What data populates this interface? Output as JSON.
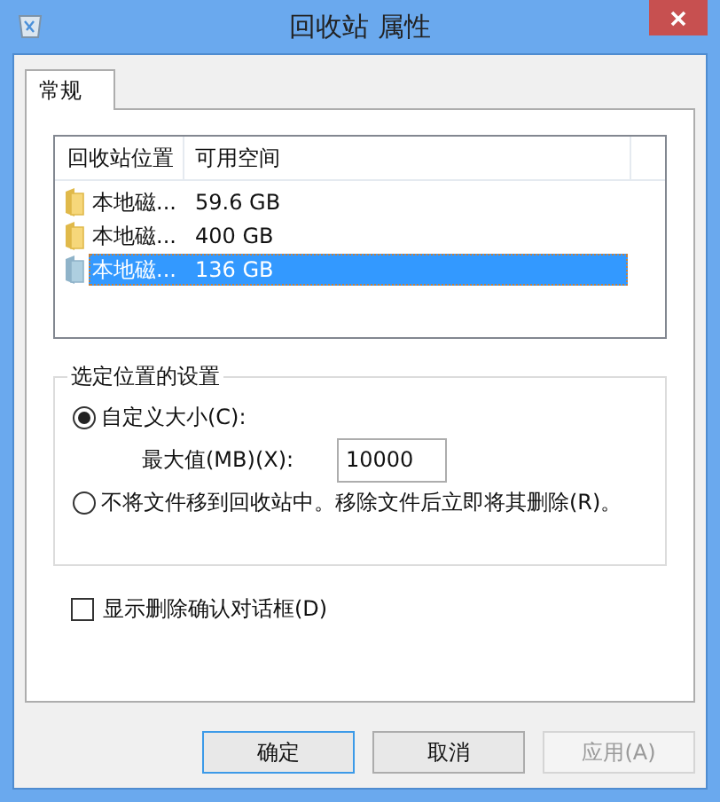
{
  "window": {
    "title": "回收站 属性"
  },
  "tabs": [
    {
      "label": "常规",
      "selected": true
    }
  ],
  "locations": {
    "columns": [
      "回收站位置",
      "可用空间"
    ],
    "rows": [
      {
        "name": "本地磁...",
        "space": "59.6 GB",
        "selected": false
      },
      {
        "name": "本地磁...",
        "space": "400 GB",
        "selected": false
      },
      {
        "name": "本地磁...",
        "space": "136 GB",
        "selected": true
      }
    ]
  },
  "settings": {
    "title": "选定位置的设置",
    "options": [
      {
        "label": "自定义大小(C):",
        "selected": true
      },
      {
        "label": "不将文件移到回收站中。移除文件后立即将其删除(R)。",
        "selected": false
      }
    ],
    "max_size": {
      "label": "最大值(MB)(X):",
      "value": "10000"
    }
  },
  "confirm": {
    "label": "显示删除确认对话框(D)",
    "checked": false
  },
  "buttons": [
    {
      "label": "确定",
      "default": true,
      "disabled": false
    },
    {
      "label": "取消",
      "default": false,
      "disabled": false
    },
    {
      "label": "应用(A)",
      "default": false,
      "disabled": true
    }
  ]
}
